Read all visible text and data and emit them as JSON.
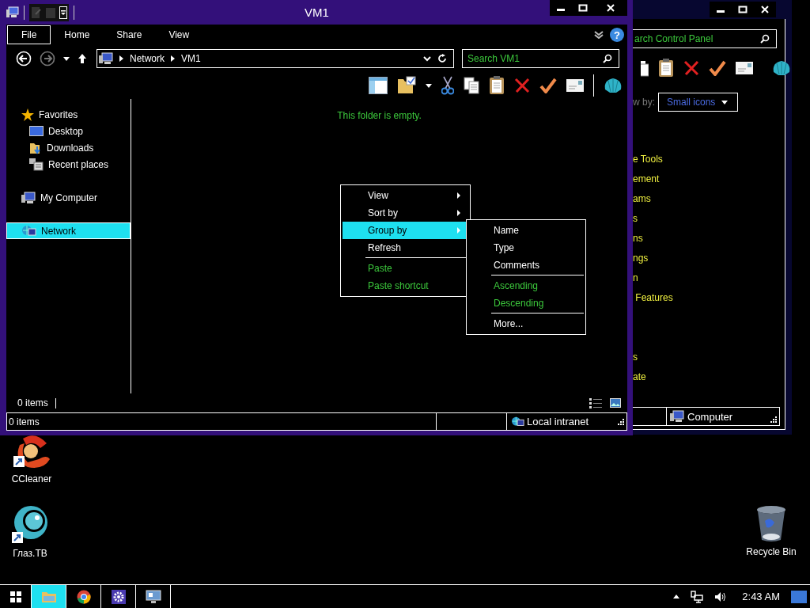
{
  "control_panel": {
    "search": {
      "placeholder": "arch Control Panel"
    },
    "view_by": {
      "label": "w by:",
      "value": "Small icons"
    },
    "items": [
      "e Tools",
      "ement",
      "ams",
      "s",
      "ns",
      "ngs",
      "n",
      " Features",
      "s",
      "ate"
    ],
    "status": "Computer"
  },
  "explorer": {
    "title": "VM1",
    "ribbon_tabs": [
      {
        "label": "File",
        "kind": "file"
      },
      {
        "label": "Home",
        "kind": "tab"
      },
      {
        "label": "Share",
        "kind": "tab"
      },
      {
        "label": "View",
        "kind": "tab"
      }
    ],
    "help": "?",
    "nav_buttons": [
      {
        "kind": "back",
        "disabled": false
      },
      {
        "kind": "forward",
        "disabled": true
      }
    ],
    "address": [
      "Network",
      "VM1"
    ],
    "search": {
      "placeholder": "Search VM1"
    },
    "nav_pane": [
      {
        "label": "Favorites",
        "kind": "favorites",
        "selected": false,
        "children": [
          {
            "label": "Desktop",
            "kind": "desktop",
            "selected": false
          },
          {
            "label": "Downloads",
            "kind": "downloads",
            "selected": false
          },
          {
            "label": "Recent places",
            "kind": "recent",
            "selected": false
          }
        ]
      },
      {
        "label": "My Computer",
        "kind": "computer",
        "selected": false
      },
      {
        "label": "Network",
        "kind": "network",
        "selected": true
      }
    ],
    "empty_message": "This folder is empty.",
    "item_count": "0 items",
    "status_bar": {
      "text": "0 items",
      "zone": "Local intranet"
    }
  },
  "context_menu": [
    {
      "kind": "item",
      "label": "View",
      "submenu": true,
      "selected": false,
      "disabled": false
    },
    {
      "kind": "item",
      "label": "Sort by",
      "submenu": true,
      "selected": false,
      "disabled": false
    },
    {
      "kind": "item",
      "label": "Group by",
      "submenu": true,
      "selected": true,
      "disabled": false
    },
    {
      "kind": "item",
      "label": "Refresh",
      "submenu": false,
      "selected": false,
      "disabled": false
    },
    {
      "kind": "separator"
    },
    {
      "kind": "item",
      "label": "Paste",
      "submenu": false,
      "selected": false,
      "disabled": true
    },
    {
      "kind": "item",
      "label": "Paste shortcut",
      "submenu": false,
      "selected": false,
      "disabled": true
    }
  ],
  "submenu": [
    {
      "kind": "item",
      "label": "Name",
      "disabled": false
    },
    {
      "kind": "item",
      "label": "Type",
      "disabled": false
    },
    {
      "kind": "item",
      "label": "Comments",
      "disabled": false
    },
    {
      "kind": "separator"
    },
    {
      "kind": "item",
      "label": "Ascending",
      "disabled": true
    },
    {
      "kind": "item",
      "label": "Descending",
      "disabled": true
    },
    {
      "kind": "separator"
    },
    {
      "kind": "item",
      "label": "More...",
      "disabled": false
    }
  ],
  "desktop_icons": [
    {
      "label": "CCleaner",
      "kind": "ccleaner"
    },
    {
      "label": "Глаз.ТВ",
      "kind": "glaz"
    },
    {
      "label": "Recycle Bin",
      "kind": "recycle"
    }
  ],
  "taskbar": {
    "apps": [
      {
        "kind": "explorer",
        "selected": true
      },
      {
        "kind": "chrome",
        "selected": false
      },
      {
        "kind": "settings",
        "selected": false
      },
      {
        "kind": "remote",
        "selected": false
      }
    ],
    "clock": "2:43 AM"
  }
}
